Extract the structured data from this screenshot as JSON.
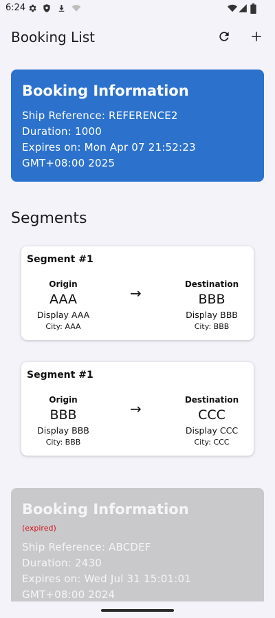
{
  "status_bar": {
    "time": "6:24",
    "icons": [
      "gear-icon",
      "shield-icon",
      "download-icon",
      "wifi-off-icon",
      "wifi-icon",
      "signal-icon",
      "battery-icon"
    ]
  },
  "app_bar": {
    "title": "Booking List",
    "actions": [
      "refresh-icon",
      "add-icon"
    ]
  },
  "bookings": [
    {
      "title": "Booking Information",
      "status": "active",
      "ship_reference": "Ship Reference: REFERENCE2",
      "duration": "Duration: 1000",
      "expires": "Expires on: Mon Apr 07 21:52:23 GMT+08:00 2025",
      "color": "#2c72cd"
    },
    {
      "title": "Booking Information",
      "status": "expired",
      "expired_label": "(expired)",
      "ship_reference": "Ship Reference: ABCDEF",
      "duration": "Duration: 2430",
      "expires": "Expires on: Wed Jul 31 15:01:01 GMT+08:00 2024",
      "color": "#c9c9cb"
    }
  ],
  "segments_title": "Segments",
  "segments": [
    {
      "title": "Segment #1",
      "origin_label": "Origin",
      "origin_code": "AAA",
      "origin_display": "Display AAA",
      "origin_city": "City: AAA",
      "arrow": "→",
      "destination_label": "Destination",
      "destination_code": "BBB",
      "destination_display": "Display BBB",
      "destination_city": "City: BBB"
    },
    {
      "title": "Segment #1",
      "origin_label": "Origin",
      "origin_code": "BBB",
      "origin_display": "Display BBB",
      "origin_city": "City: BBB",
      "arrow": "→",
      "destination_label": "Destination",
      "destination_code": "CCC",
      "destination_display": "Display CCC",
      "destination_city": "City: CCC"
    }
  ],
  "colors": {
    "background": "#f4f3f9",
    "primary": "#2c72cd",
    "expired_text": "#d0121b"
  }
}
